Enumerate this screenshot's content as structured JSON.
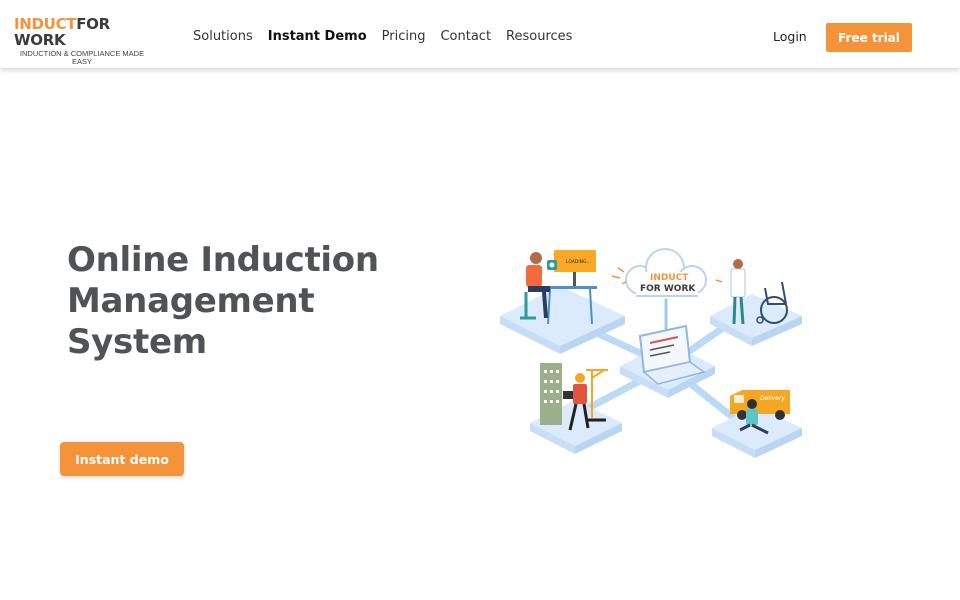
{
  "logo": {
    "part1": "INDUCT",
    "part2": "FOR WORK",
    "tagline": "INDUCTION & COMPLIANCE MADE EASY"
  },
  "nav": {
    "items": [
      {
        "label": "Solutions"
      },
      {
        "label": "Instant Demo"
      },
      {
        "label": "Pricing"
      },
      {
        "label": "Contact"
      },
      {
        "label": "Resources"
      }
    ],
    "active": "Instant Demo"
  },
  "header": {
    "login_label": "Login",
    "free_trial_label": "Free trial"
  },
  "hero": {
    "title": "Online Induction Management System",
    "cta_label": "Instant demo"
  },
  "illustration": {
    "cloud_brand_line1": "INDUCT",
    "cloud_brand_line2": "FOR WORK",
    "screen_text": "LOADING...",
    "van_text": "Delivery"
  },
  "colors": {
    "accent": "#f5933b",
    "heading": "#4f5256",
    "platform": "#dcebfb"
  }
}
